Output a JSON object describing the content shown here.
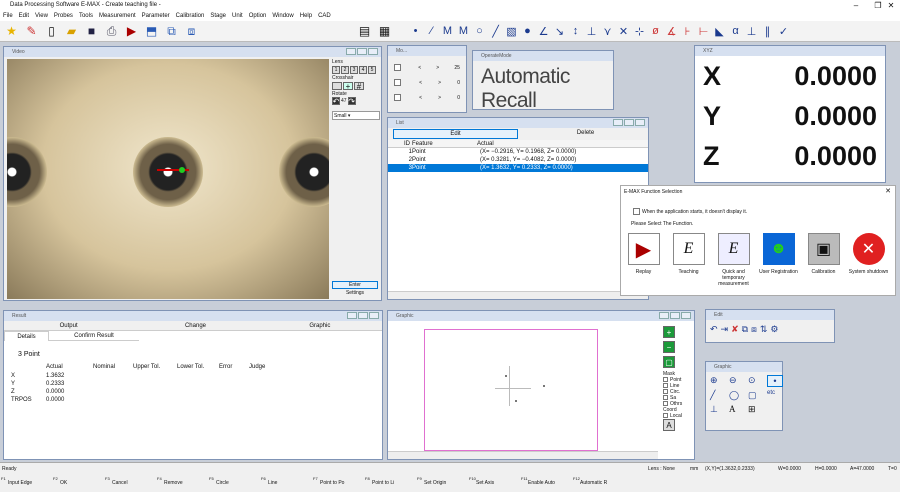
{
  "app": {
    "title": "Data Processing Software E-MAX - Create teaching file -"
  },
  "menu": [
    "File",
    "Edit",
    "View",
    "Probes",
    "Tools",
    "Measurement",
    "Parameter",
    "Calibration",
    "Stage",
    "Unit",
    "Option",
    "Window",
    "Help",
    "CAD"
  ],
  "video": {
    "title": "Video",
    "lens_label": "Lens",
    "crosshair_label": "Crosshair",
    "rotate_label": "Rotate",
    "rotate_value": "47",
    "size_value": "Small",
    "enter_label": "Enter",
    "settings_label": "Settings"
  },
  "mini": {
    "title": "Mo...",
    "rows": [
      {
        "value": "25"
      },
      {
        "value": "0"
      },
      {
        "value": "0"
      }
    ]
  },
  "operation": {
    "title": "OperateMode",
    "mode": "Automatic Recall"
  },
  "xyz": {
    "title": "XYZ",
    "x_label": "X",
    "x_value": "0.0000",
    "y_label": "Y",
    "y_value": "0.0000",
    "z_label": "Z",
    "z_value": "0.0000"
  },
  "list": {
    "title": "List",
    "edit_label": "Edit",
    "delete_label": "Delete",
    "headers": [
      "ID",
      "Feature",
      "Actual"
    ],
    "rows": [
      {
        "id": "1",
        "feature": "Point",
        "actual": "(X= −0.2916, Y= 0.1968, Z= 0.0000)"
      },
      {
        "id": "2",
        "feature": "Point",
        "actual": "(X= 0.3281, Y= −0.4082, Z= 0.0000)"
      },
      {
        "id": "3",
        "feature": "Point",
        "actual": "(X= 1.3632, Y= 0.2333, Z= 0.0000)"
      }
    ]
  },
  "func": {
    "title": "E-MAX Function Selection",
    "checkbox_label": "When the application starts, it doesn't display it.",
    "prompt": "Please Select The Function.",
    "items": [
      "Replay",
      "Teaching",
      "Quick and temporary measurement",
      "User Registration",
      "Calibration",
      "System shutdown"
    ]
  },
  "result": {
    "title": "Result",
    "tabs_top": [
      "Output",
      "Change",
      "Graphic"
    ],
    "tabs": [
      "Details",
      "Confirm Result"
    ],
    "heading": "3  Point",
    "columns": [
      "Actual",
      "Nominal",
      "Upper Tol.",
      "Lower Tol.",
      "Error",
      "Judge"
    ],
    "rows": [
      {
        "label": "X",
        "actual": "1.3632"
      },
      {
        "label": "Y",
        "actual": "0.2333"
      },
      {
        "label": "Z",
        "actual": "0.0000"
      },
      {
        "label": "TRPOS",
        "actual": "0.0000"
      }
    ]
  },
  "graphic": {
    "title": "Graphic",
    "mask_label": "Mask",
    "checks": [
      "Point",
      "Line",
      "Circ.",
      "Sa",
      "Othrs"
    ],
    "coord_label": "Coord",
    "local_label": "Local"
  },
  "edit_palette": {
    "title": "Edit"
  },
  "graphic_palette": {
    "title": "Graphic"
  },
  "status": {
    "left": "Ready",
    "lens": "Lens : None",
    "unit": "mm",
    "xy": "(X,Y)=(1.3632,0.2333)",
    "w": "W=0.0000",
    "h": "H=0.0000",
    "a": "A=47.0000",
    "t": "T=0"
  },
  "fkeys": [
    {
      "num": "F1",
      "label": "Input Edge"
    },
    {
      "num": "F2",
      "label": "OK"
    },
    {
      "num": "F3",
      "label": "Cancel"
    },
    {
      "num": "F4",
      "label": "Remove"
    },
    {
      "num": "F5",
      "label": "Circle"
    },
    {
      "num": "F6",
      "label": "Line"
    },
    {
      "num": "F7",
      "label": "Point to Po"
    },
    {
      "num": "F8",
      "label": "Point to Li"
    },
    {
      "num": "F9",
      "label": "Set Origin"
    },
    {
      "num": "F10",
      "label": "Set Axis"
    },
    {
      "num": "F11",
      "label": "Enable Auto"
    },
    {
      "num": "F12",
      "label": "Automatic R"
    }
  ]
}
